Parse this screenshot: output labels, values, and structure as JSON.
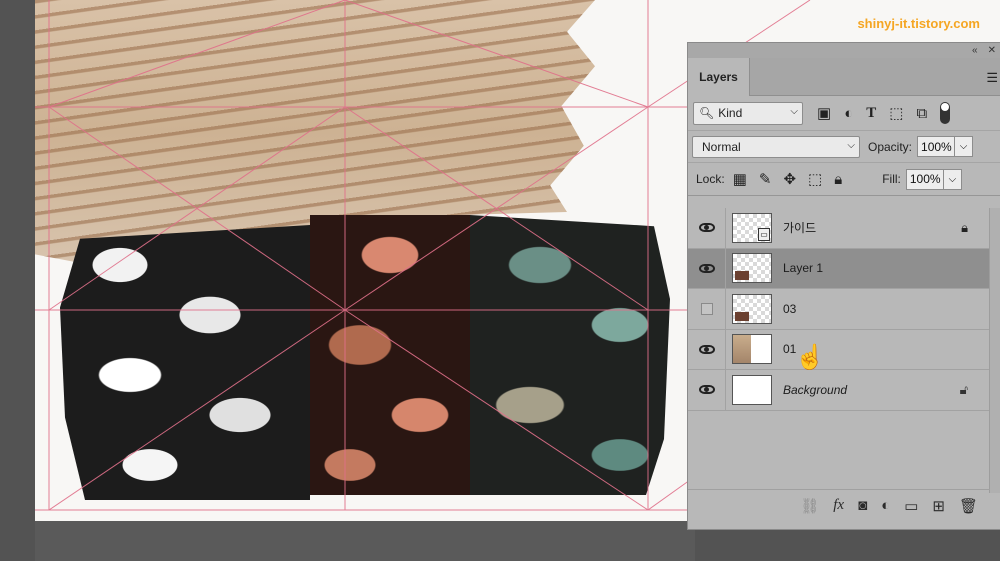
{
  "watermark": "shinyj-it.tistory.com",
  "panel": {
    "tab_label": "Layers",
    "filter": {
      "kind_label": "Kind",
      "icons": [
        "image-filter-icon",
        "adjustment-filter-icon",
        "type-filter-icon",
        "shape-filter-icon",
        "smart-object-filter-icon"
      ]
    },
    "blend_mode": "Normal",
    "opacity_label": "Opacity:",
    "opacity_value": "100%",
    "lock_label": "Lock:",
    "fill_label": "Fill:",
    "fill_value": "100%",
    "layers": [
      {
        "name": "가이드",
        "visible": true,
        "locked": true,
        "selected": false
      },
      {
        "name": "Layer 1",
        "visible": true,
        "locked": false,
        "selected": true
      },
      {
        "name": "03",
        "visible": false,
        "locked": false,
        "selected": false
      },
      {
        "name": "01",
        "visible": true,
        "locked": false,
        "selected": false
      },
      {
        "name": "Background",
        "visible": true,
        "locked": true,
        "selected": false
      }
    ],
    "footer_icons": [
      "link-icon",
      "fx-icon",
      "mask-icon",
      "adjustment-icon",
      "folder-icon",
      "new-layer-icon",
      "trash-icon"
    ]
  },
  "colors": {
    "guide": "#e0708a",
    "watermark": "#f5a623",
    "panel_bg": "#b8b8b8",
    "selected_row": "#8f8f8f"
  }
}
